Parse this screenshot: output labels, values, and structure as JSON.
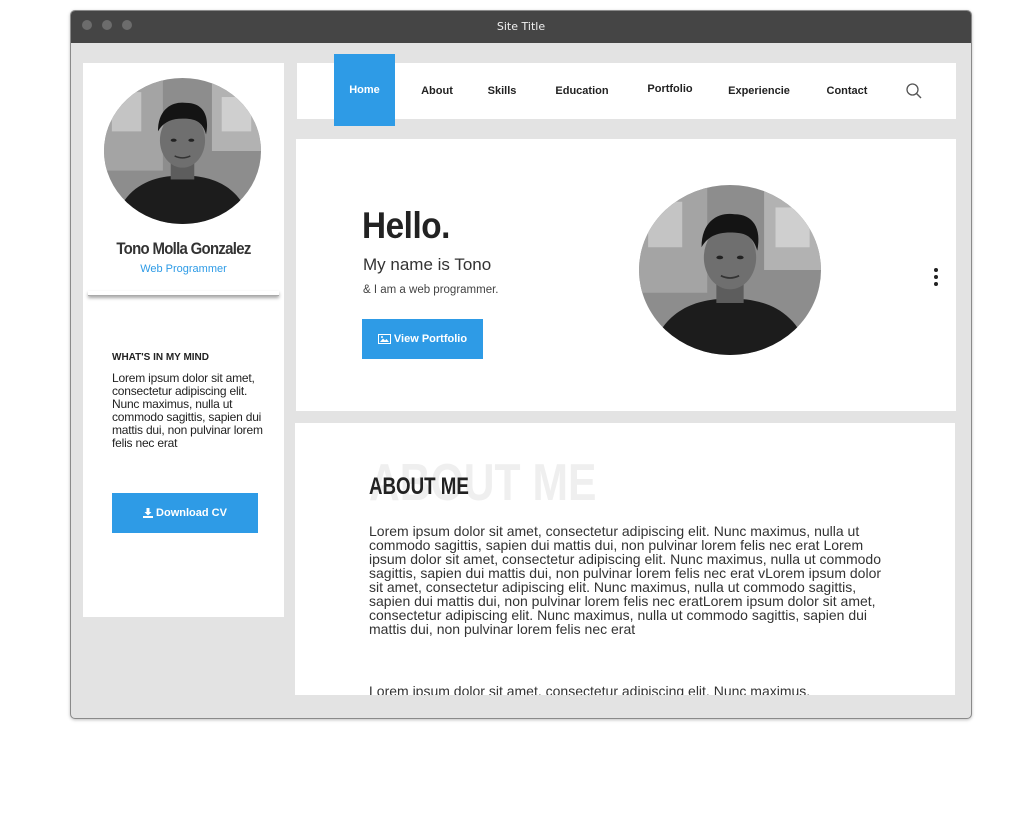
{
  "window": {
    "title": "Site Title"
  },
  "sidebar": {
    "name": "Tono Molla Gonzalez",
    "role": "Web Programmer",
    "mind_title": "WHAT'S IN MY MIND",
    "mind_text": "Lorem ipsum dolor sit amet, consectetur adipiscing elit. Nunc maximus, nulla ut commodo sagittis, sapien dui mattis dui, non pulvinar lorem felis nec erat",
    "cv_button": "Download CV",
    "cv_icon": "download-icon"
  },
  "nav": {
    "items": [
      "Home",
      "About",
      "Skills",
      "Education",
      "Portfolio",
      "Experiencie",
      "Contact"
    ],
    "active": "Home",
    "search_icon": "search-icon"
  },
  "hero": {
    "greeting": "Hello.",
    "name_line": "My name is Tono",
    "tagline": "& I am a web programmer.",
    "button": "View Portfolio",
    "button_icon": "image-icon"
  },
  "about": {
    "background_title": "ABOUT ME",
    "title": "ABOUT ME",
    "paragraphs": [
      "Lorem ipsum dolor sit amet, consectetur adipiscing elit. Nunc maximus, nulla ut commodo sagittis, sapien dui mattis dui, non pulvinar lorem felis nec erat Lorem ipsum dolor sit amet, consectetur adipiscing elit. Nunc maximus, nulla ut commodo sagittis, sapien dui mattis dui, non pulvinar lorem felis nec erat  vLorem ipsum dolor sit amet, consectetur adipiscing elit. Nunc maximus, nulla ut commodo sagittis, sapien dui mattis dui, non pulvinar lorem felis nec eratLorem ipsum dolor sit amet, consectetur adipiscing elit. Nunc maximus, nulla ut commodo sagittis, sapien dui mattis dui, non pulvinar lorem felis nec erat",
      "Lorem ipsum dolor sit amet, consectetur adipiscing elit. Nunc maximus,"
    ]
  },
  "colors": {
    "accent": "#2e9be6",
    "titlebar": "#454545",
    "page_bg": "#e3e3e3"
  }
}
